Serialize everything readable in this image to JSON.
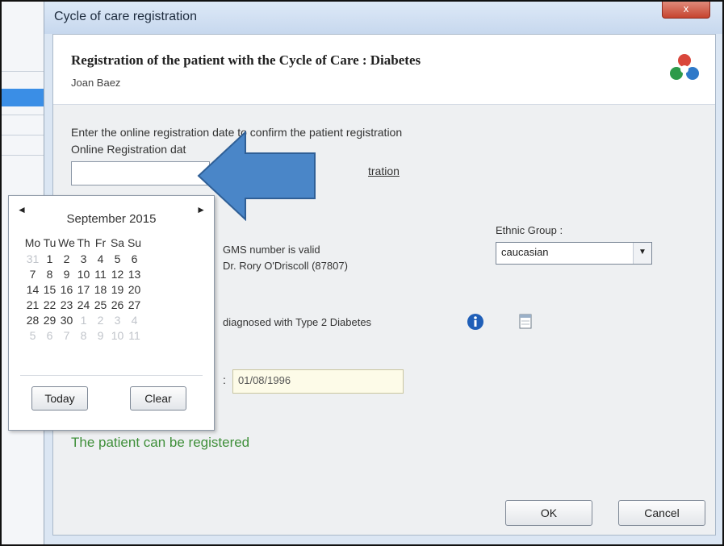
{
  "window": {
    "title": "Cycle of care registration",
    "close_glyph": "x"
  },
  "header": {
    "title": "Registration of the patient with the Cycle of Care : Diabetes",
    "patient": "Joan Baez",
    "logo_icon": "care-cycle-logo"
  },
  "form": {
    "instruction": "Enter the online registration date to confirm the patient registration",
    "date_label": "Online Registration dat",
    "date_value": "",
    "link_partial": "tration",
    "gms_status": "GMS number is valid",
    "doctor": "Dr. Rory O'Driscoll (87807)",
    "ethnic_label": "Ethnic Group :",
    "ethnic_value": "caucasian",
    "diagnosis": "diagnosed with Type 2 Diabetes",
    "date_field_colon": ":",
    "diagnosis_date": "01/08/1996",
    "status_message": "The patient can be registered"
  },
  "buttons": {
    "ok": "OK",
    "cancel": "Cancel"
  },
  "calendar": {
    "prev": "◄",
    "next": "►",
    "month": "September 2015",
    "weekdays": [
      "Mo",
      "Tu",
      "We",
      "Th",
      "Fr",
      "Sa",
      "Su"
    ],
    "weeks": [
      [
        "31",
        "1",
        "2",
        "3",
        "4",
        "5",
        "6"
      ],
      [
        "7",
        "8",
        "9",
        "10",
        "11",
        "12",
        "13"
      ],
      [
        "14",
        "15",
        "16",
        "17",
        "18",
        "19",
        "20"
      ],
      [
        "21",
        "22",
        "23",
        "24",
        "25",
        "26",
        "27"
      ],
      [
        "28",
        "29",
        "30",
        "1",
        "2",
        "3",
        "4"
      ],
      [
        "5",
        "6",
        "7",
        "8",
        "9",
        "10",
        "11"
      ]
    ],
    "today_label": "Today",
    "clear_label": "Clear"
  },
  "colors": {
    "status_green": "#3f8f3a",
    "info_blue": "#1f5fb8",
    "annotation_arrow": "#4a86c8"
  }
}
